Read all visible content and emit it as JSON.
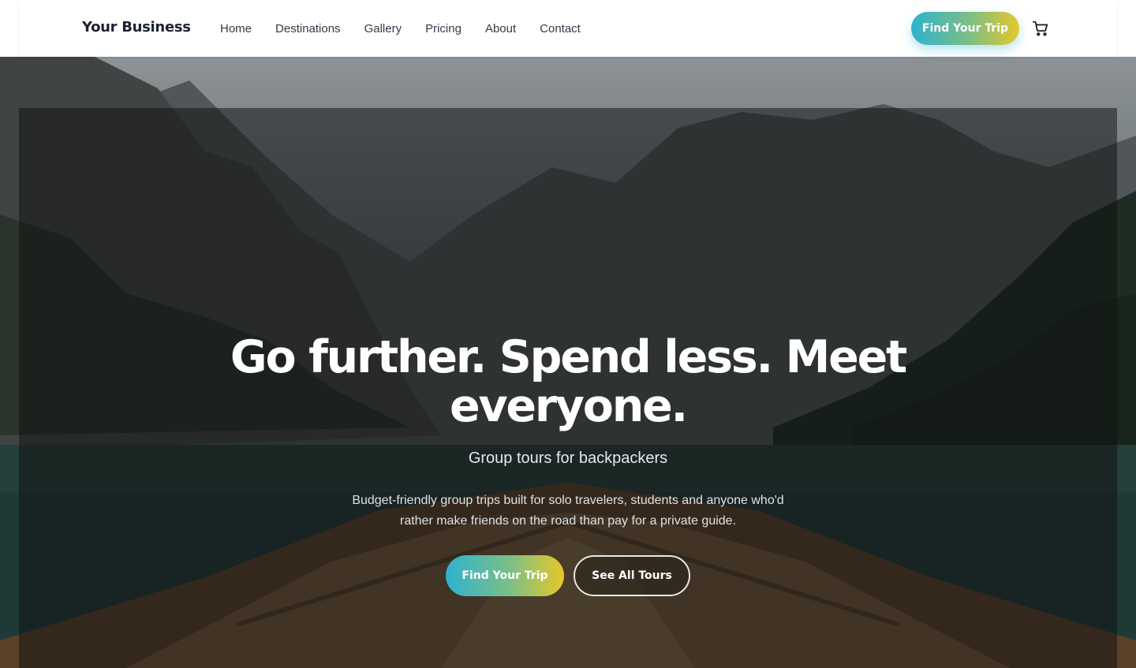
{
  "header": {
    "brand": "Your Business",
    "nav": [
      "Home",
      "Destinations",
      "Gallery",
      "Pricing",
      "About",
      "Contact"
    ],
    "cta_label": "Find Your Trip",
    "cart_icon": "cart-icon"
  },
  "hero": {
    "title": "Go further. Spend less. Meet everyone.",
    "subtitle": "Group tours for backpackers",
    "description": "Budget-friendly group trips built for solo travelers, students and anyone who'd rather make friends on the road than pay for a private guide.",
    "primary_label": "Find Your Trip",
    "secondary_label": "See All Tours"
  },
  "colors": {
    "gradient_start": "#2fb2cf",
    "gradient_mid": "#7dbf85",
    "gradient_end": "#e6c82a",
    "brand_text": "#1c2230",
    "overlay": "#121212"
  }
}
